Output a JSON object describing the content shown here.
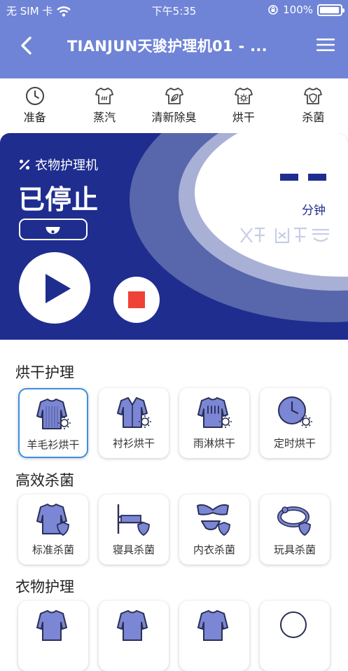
{
  "status_bar": {
    "carrier": "无 SIM 卡",
    "time": "下午5:35",
    "battery": "100%"
  },
  "nav": {
    "title": "TIANJUN天骏护理机01 - ..."
  },
  "modes": [
    {
      "label": "准备",
      "icon": "clock-icon"
    },
    {
      "label": "蒸汽",
      "icon": "steam-shirt-icon"
    },
    {
      "label": "清新除臭",
      "icon": "leaf-shirt-icon"
    },
    {
      "label": "烘干",
      "icon": "sun-shirt-icon"
    },
    {
      "label": "杀菌",
      "icon": "shield-shirt-icon"
    }
  ],
  "card": {
    "device_name": "衣物护理机",
    "state": "已停止",
    "timer_unit": "分钟",
    "colors": {
      "primary": "#1f2d8f",
      "accent": "#6f84d6",
      "stop": "#ef4136"
    }
  },
  "sections": [
    {
      "title": "烘干护理",
      "items": [
        {
          "label": "羊毛衫烘干",
          "icon": "sweater-dry-icon",
          "selected": true
        },
        {
          "label": "衬衫烘干",
          "icon": "shirt-dry-icon"
        },
        {
          "label": "雨淋烘干",
          "icon": "rain-dry-icon"
        },
        {
          "label": "定时烘干",
          "icon": "timer-dry-icon"
        }
      ]
    },
    {
      "title": "高效杀菌",
      "items": [
        {
          "label": "标准杀菌",
          "icon": "standard-sterilize-icon"
        },
        {
          "label": "寝具杀菌",
          "icon": "bedding-sterilize-icon"
        },
        {
          "label": "内衣杀菌",
          "icon": "underwear-sterilize-icon"
        },
        {
          "label": "玩具杀菌",
          "icon": "toy-sterilize-icon"
        }
      ]
    },
    {
      "title": "衣物护理",
      "items": []
    }
  ]
}
